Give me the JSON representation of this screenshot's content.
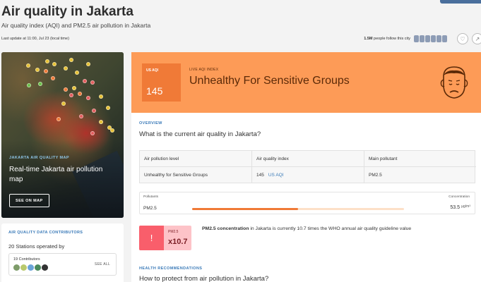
{
  "header": {
    "title": "Air quality in Jakarta",
    "subtitle": "Air quality index (AQI) and PM2.5 air pollution in Jakarta",
    "last_update": "Last update at 11:00, Jul 23 (local time)",
    "followers_count": "1.5M",
    "followers_text": "people follow this city",
    "heart_icon": "heart-icon",
    "share_icon": "share-icon"
  },
  "map_card": {
    "kicker": "JAKARTA AIR QUALITY MAP",
    "title": "Real-time Jakarta air pollution map",
    "button": "SEE ON MAP"
  },
  "contributors": {
    "kicker": "AIR QUALITY DATA CONTRIBUTORS",
    "stations": "20 Stations operated by",
    "count": "19 Contributors",
    "see_all": "SEE ALL"
  },
  "aqi_banner": {
    "label": "US AQI",
    "value": "145",
    "live_label": "LIVE AQI INDEX",
    "level": "Unhealthy For Sensitive Groups",
    "icon": "sad-face-icon",
    "color": "#fd9b57",
    "box_color": "#f07a37"
  },
  "overview": {
    "kicker": "OVERVIEW",
    "question": "What is the current air quality in Jakarta?",
    "table": {
      "headers": [
        "Air pollution level",
        "Air quality index",
        "Main pollutant"
      ],
      "row": {
        "level": "Unhealthy for Sensitive Groups",
        "aqi_value": "145",
        "aqi_unit": "US AQI",
        "pollutant": "PM2.5"
      }
    }
  },
  "pollutants": {
    "header_left": "Pollutants",
    "header_right": "Concentration",
    "items": [
      {
        "name": "PM2.5",
        "value": "53.5",
        "unit": "µg/m³",
        "level_fraction": 0.5
      }
    ]
  },
  "pm_comparison": {
    "label": "PM2.5",
    "multiplier": "x10.7",
    "warn_icon": "exclamation-icon",
    "bold": "PM2.5 concentration",
    "text": " in Jakarta is currently 10.7 times the WHO annual air quality guideline value"
  },
  "health": {
    "kicker": "HEALTH RECOMMENDATIONS",
    "question": "How to protect from air pollution in Jakarta?"
  }
}
